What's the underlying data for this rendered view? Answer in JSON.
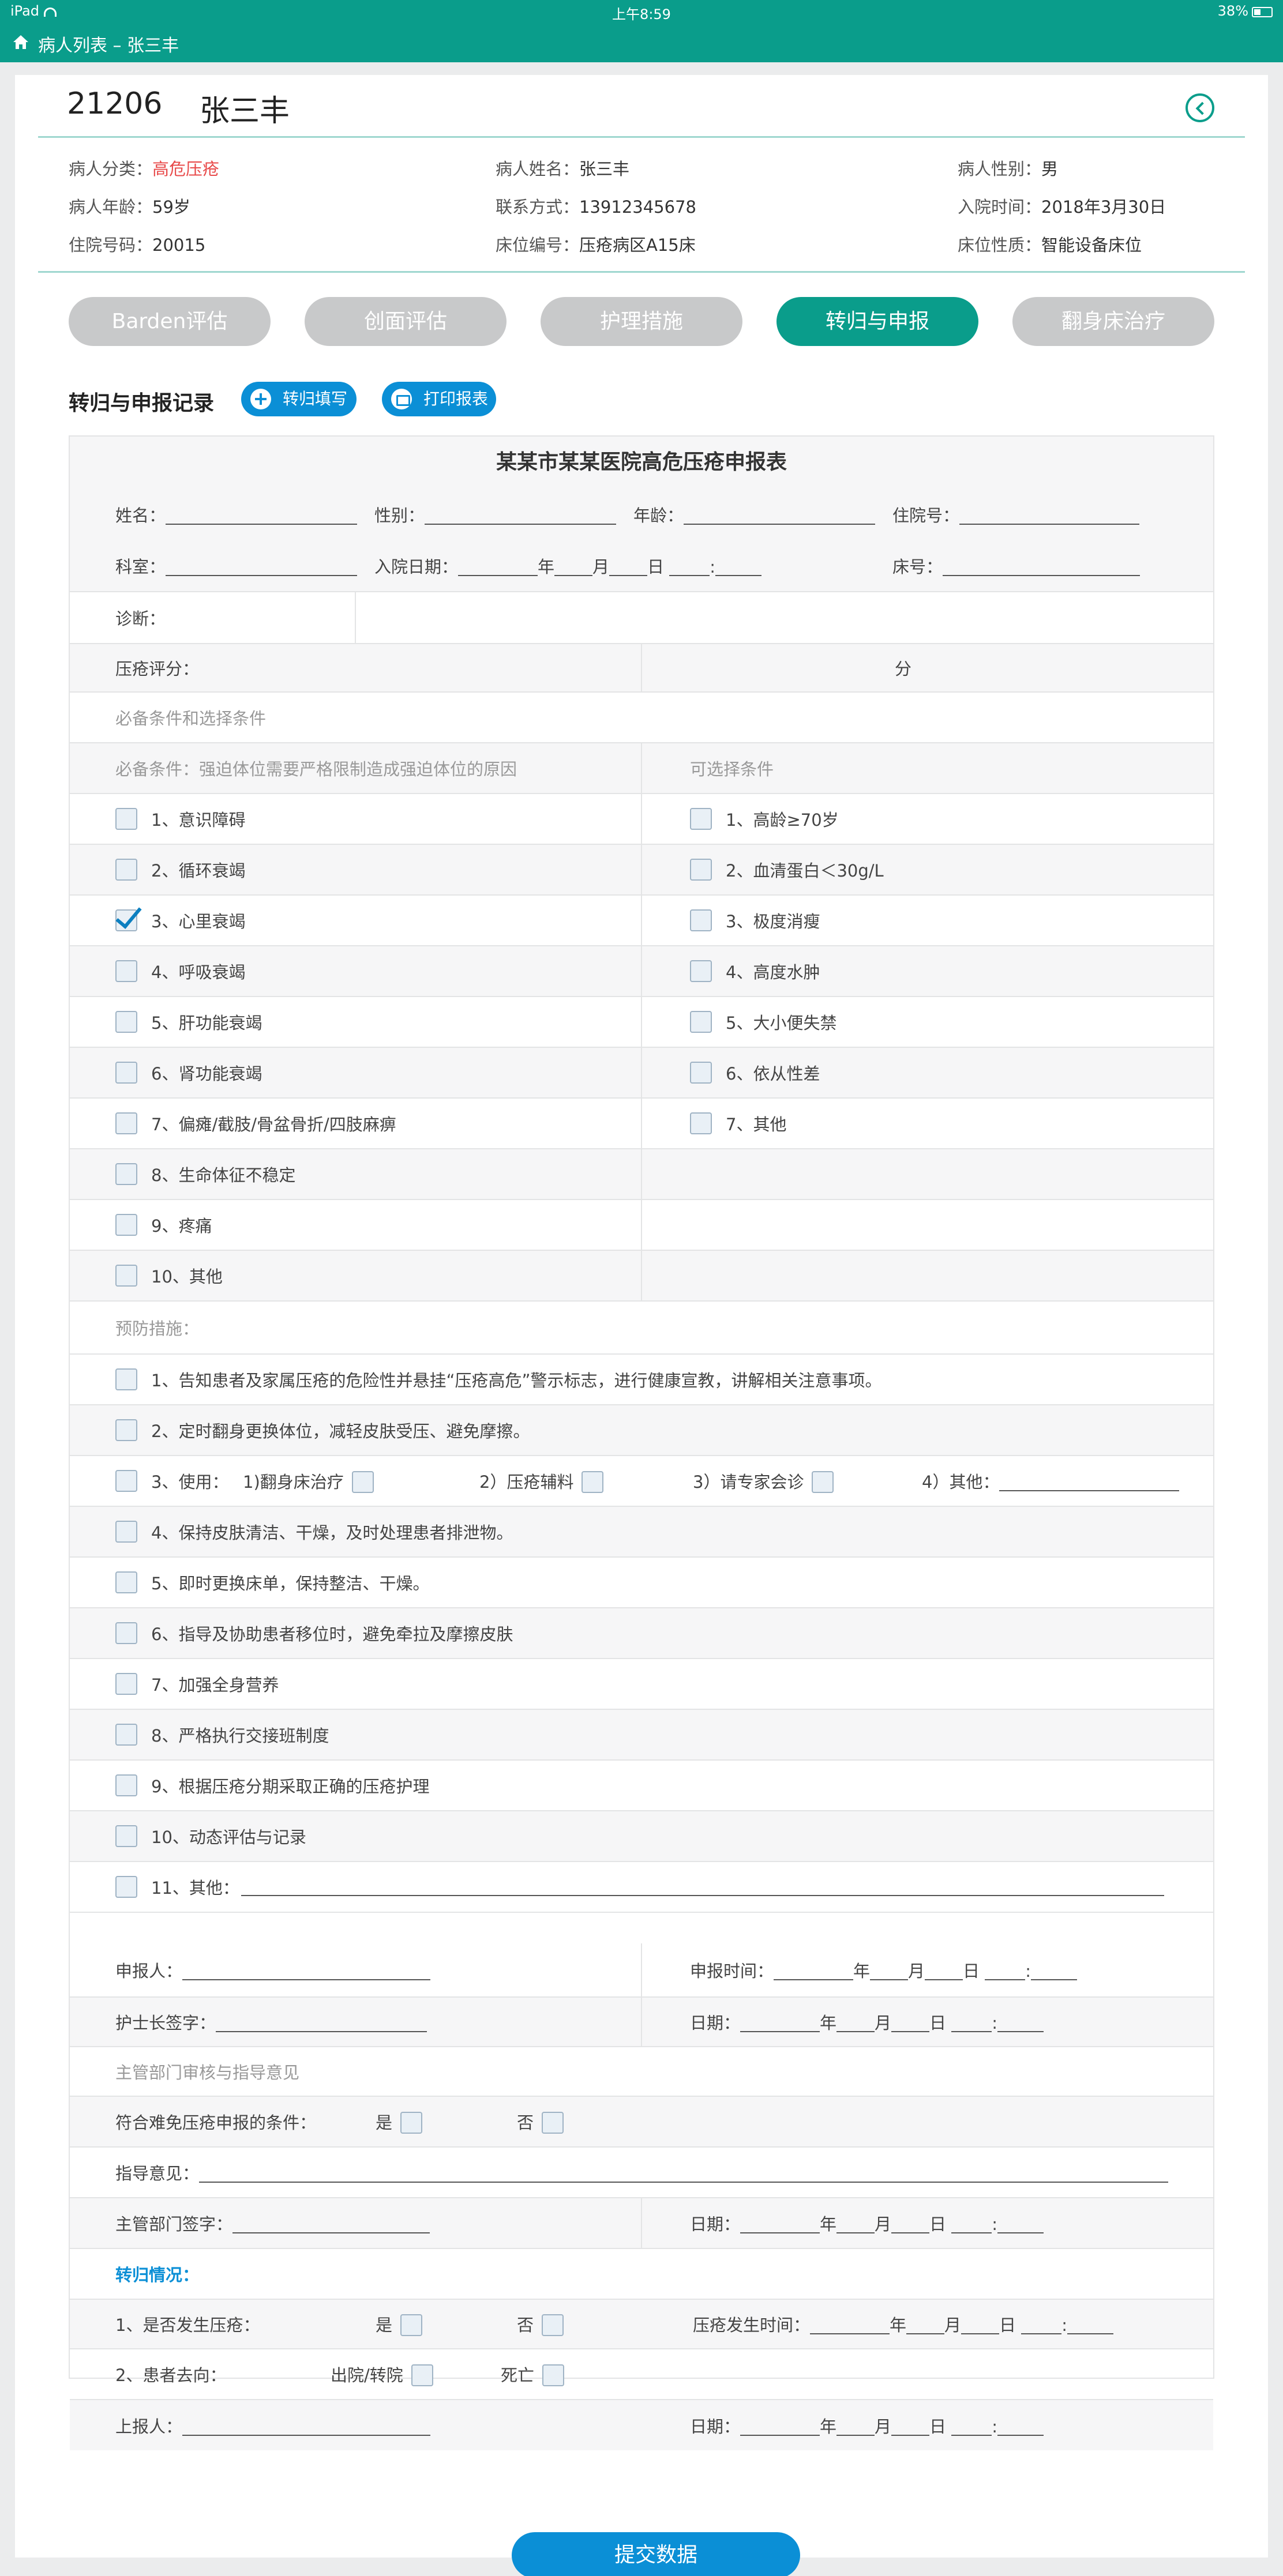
{
  "status_bar": {
    "device": "iPad",
    "time": "上午8:59",
    "battery": "38%"
  },
  "nav": {
    "breadcrumb": "病人列表 – 张三丰"
  },
  "patient": {
    "id": "21206",
    "name": "张三丰",
    "info": [
      {
        "label": "病人分类：",
        "value": "高危压疮",
        "highlight": true
      },
      {
        "label": "病人姓名：",
        "value": "张三丰"
      },
      {
        "label": "病人性别：",
        "value": "男"
      },
      {
        "label": "病人年龄：",
        "value": "59岁"
      },
      {
        "label": "联系方式：",
        "value": "13912345678"
      },
      {
        "label": "入院时间：",
        "value": "2018年3月30日"
      },
      {
        "label": "住院号码：",
        "value": "20015"
      },
      {
        "label": "床位编号：",
        "value": "压疮病区A15床"
      },
      {
        "label": "床位性质：",
        "value": "智能设备床位"
      }
    ]
  },
  "tabs": [
    "Barden评估",
    "创面评估",
    "护理措施",
    "转归与申报",
    "翻身床治疗"
  ],
  "active_tab": 3,
  "section": {
    "title": "转归与申报记录",
    "btn_fill": "转归填写",
    "btn_print": "打印报表"
  },
  "form": {
    "title": "某某市某某医院高危压疮申报表",
    "name_label": "姓名：",
    "gender_label": "性别：",
    "age_label": "年龄：",
    "hosp_no_label": "住院号：",
    "dept_label": "科室：",
    "admit_date_label": "入院日期：",
    "bed_label": "床号：",
    "date_y": "年",
    "date_m": "月",
    "date_d": "日",
    "colon": ":",
    "diagnosis_label": "诊断：",
    "score_label": "压疮评分：",
    "score_unit": "分",
    "conditions_header": "必备条件和选择条件",
    "required_header": "必备条件：强迫体位需要严格限制造成强迫体位的原因",
    "optional_header": "可选择条件",
    "required": [
      {
        "label": "1、意识障碍",
        "checked": false
      },
      {
        "label": "2、循环衰竭",
        "checked": false
      },
      {
        "label": "3、心里衰竭",
        "checked": true
      },
      {
        "label": "4、呼吸衰竭",
        "checked": false
      },
      {
        "label": "5、肝功能衰竭",
        "checked": false
      },
      {
        "label": "6、肾功能衰竭",
        "checked": false
      },
      {
        "label": "7、偏瘫/截肢/骨盆骨折/四肢麻痹",
        "checked": false
      },
      {
        "label": "8、生命体征不稳定",
        "checked": false
      },
      {
        "label": "9、疼痛",
        "checked": false
      },
      {
        "label": "10、其他",
        "checked": false
      }
    ],
    "optional": [
      {
        "label": "1、高龄≥70岁",
        "checked": false
      },
      {
        "label": "2、血清蛋白＜30g/L",
        "checked": false
      },
      {
        "label": "3、极度消瘦",
        "checked": false
      },
      {
        "label": "4、高度水肿",
        "checked": false
      },
      {
        "label": "5、大小便失禁",
        "checked": false
      },
      {
        "label": "6、依从性差",
        "checked": false
      },
      {
        "label": "7、其他",
        "checked": false
      }
    ],
    "prevention_header": "预防措施：",
    "prevention": [
      "1、告知患者及家属压疮的危险性并悬挂“压疮高危”警示标志，进行健康宣教，讲解相关注意事项。",
      "2、定时翻身更换体位，减轻皮肤受压、避免摩擦。",
      "3、使用：",
      "4、保持皮肤清洁、干燥，及时处理患者排泄物。",
      "5、即时更换床单，保持整洁、干燥。",
      "6、指导及协助患者移位时，避免牵拉及摩擦皮肤",
      "7、加强全身营养",
      "8、严格执行交接班制度",
      "9、根据压疮分期采取正确的压疮护理",
      "10、动态评估与记录",
      "11、其他："
    ],
    "use_options": [
      "1)翻身床治疗",
      "2）压疮辅料",
      "3）请专家会诊",
      "4）其他："
    ],
    "reporter_label": "申报人：",
    "report_time_label": "申报时间：",
    "head_nurse_label": "护士长签字：",
    "date_label": "日期：",
    "review_header": "主管部门审核与指导意见",
    "meets_label": "符合难免压疮申报的条件：",
    "yes": "是",
    "no": "否",
    "guidance_label": "指导意见：",
    "dept_sign_label": "主管部门签字：",
    "outcome_header": "转归情况：",
    "occurred_label": "1、是否发生压疮：",
    "occur_time_label": "压疮发生时间：",
    "destination_label": "2、患者去向：",
    "discharge_label": "出院/转院",
    "death_label": "死亡",
    "upper_reporter_label": "上报人："
  },
  "submit_label": "提交数据"
}
